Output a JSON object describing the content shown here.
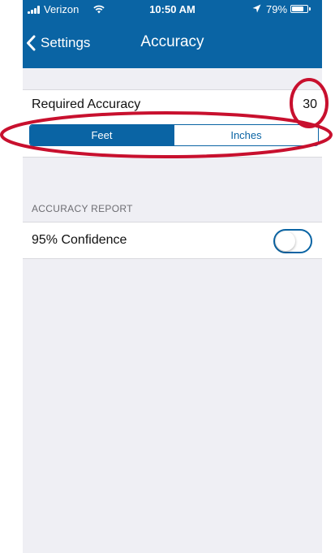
{
  "status_bar": {
    "carrier": "Verizon",
    "time": "10:50 AM",
    "battery": "79%",
    "battery_level": 0.79,
    "icons": [
      "signal-icon",
      "wifi-icon",
      "location-arrow-icon",
      "battery-icon"
    ]
  },
  "nav": {
    "back_label": "Settings",
    "title": "Accuracy"
  },
  "required_accuracy": {
    "label": "Required Accuracy",
    "value": "30",
    "units": [
      {
        "label": "Feet",
        "selected": true
      },
      {
        "label": "Inches",
        "selected": false
      }
    ]
  },
  "accuracy_report": {
    "header": "ACCURACY REPORT",
    "confidence_label": "95% Confidence",
    "confidence_enabled": false
  },
  "colors": {
    "accent": "#0a64a4",
    "background": "#efeff4",
    "annotation": "#c8102e"
  }
}
